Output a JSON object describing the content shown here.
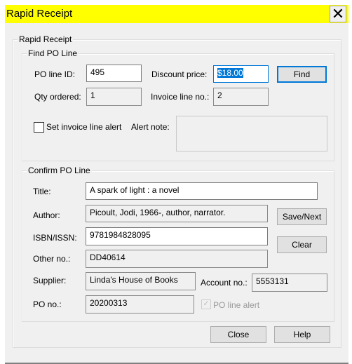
{
  "window": {
    "title": "Rapid Receipt",
    "close_glyph": "✕"
  },
  "outer_group": {
    "label": "Rapid Receipt"
  },
  "find_po": {
    "label": "Find PO Line",
    "po_line_id_label": "PO line ID:",
    "po_line_id_value": "495",
    "discount_price_label": "Discount price:",
    "discount_price_value": "$18.00",
    "find_button": "Find",
    "qty_ordered_label": "Qty ordered:",
    "qty_ordered_value": "1",
    "invoice_line_label": "Invoice line no.:",
    "invoice_line_value": "2",
    "set_alert_label": "Set invoice line alert",
    "set_alert_checked": false,
    "alert_note_label": "Alert note:",
    "alert_note_value": ""
  },
  "confirm_po": {
    "label": "Confirm PO Line",
    "title_label": "Title:",
    "title_value": "A spark of light : a novel",
    "author_label": "Author:",
    "author_value": "Picoult, Jodi, 1966-, author, narrator.",
    "isbn_label": "ISBN/ISSN:",
    "isbn_value": "9781984828095",
    "other_no_label": "Other no.:",
    "other_no_value": "DD40614",
    "supplier_label": "Supplier:",
    "supplier_value": "Linda's House of Books",
    "account_label": "Account no.:",
    "account_value": "5553131",
    "po_no_label": "PO no.:",
    "po_no_value": "20200313",
    "po_line_alert_label": "PO line alert",
    "po_line_alert_checked": true,
    "save_next_button": "Save/Next",
    "clear_button": "Clear"
  },
  "footer": {
    "close_button": "Close",
    "help_button": "Help"
  }
}
